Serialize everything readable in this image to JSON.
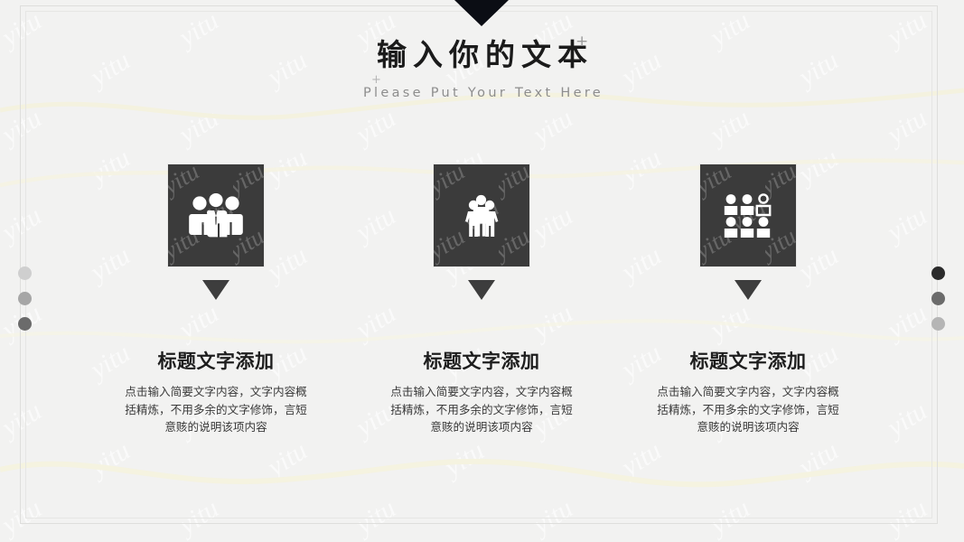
{
  "slide": {
    "background_color": "#f2f2f1",
    "watermark_text": "yitu",
    "accent_dark": "#3b3b3b",
    "accent_cream": "#f6f4e3"
  },
  "title": {
    "main": "输入你的文本",
    "sub": "Please Put Your Text Here",
    "plus_a": "+",
    "plus_b": "+"
  },
  "side_dots": {
    "left": [
      "#cfcfcf",
      "#a6a6a6",
      "#6b6b6b"
    ],
    "right": [
      "#2b2b2b",
      "#6b6b6b",
      "#b5b5b5"
    ]
  },
  "columns": [
    {
      "icon_name": "business-team-icon",
      "heading": "标题文字添加",
      "body": "点击输入简要文字内容，文字内容概括精炼，不用多余的文字修饰，言短意赅的说明该项内容"
    },
    {
      "icon_name": "family-group-icon",
      "heading": "标题文字添加",
      "body": "点击输入简要文字内容，文字内容概括精炼，不用多余的文字修饰，言短意赅的说明该项内容"
    },
    {
      "icon_name": "people-grid-selected-icon",
      "heading": "标题文字添加",
      "body": "点击输入简要文字内容，文字内容概括精炼，不用多余的文字修饰，言短意赅的说明该项内容"
    }
  ]
}
